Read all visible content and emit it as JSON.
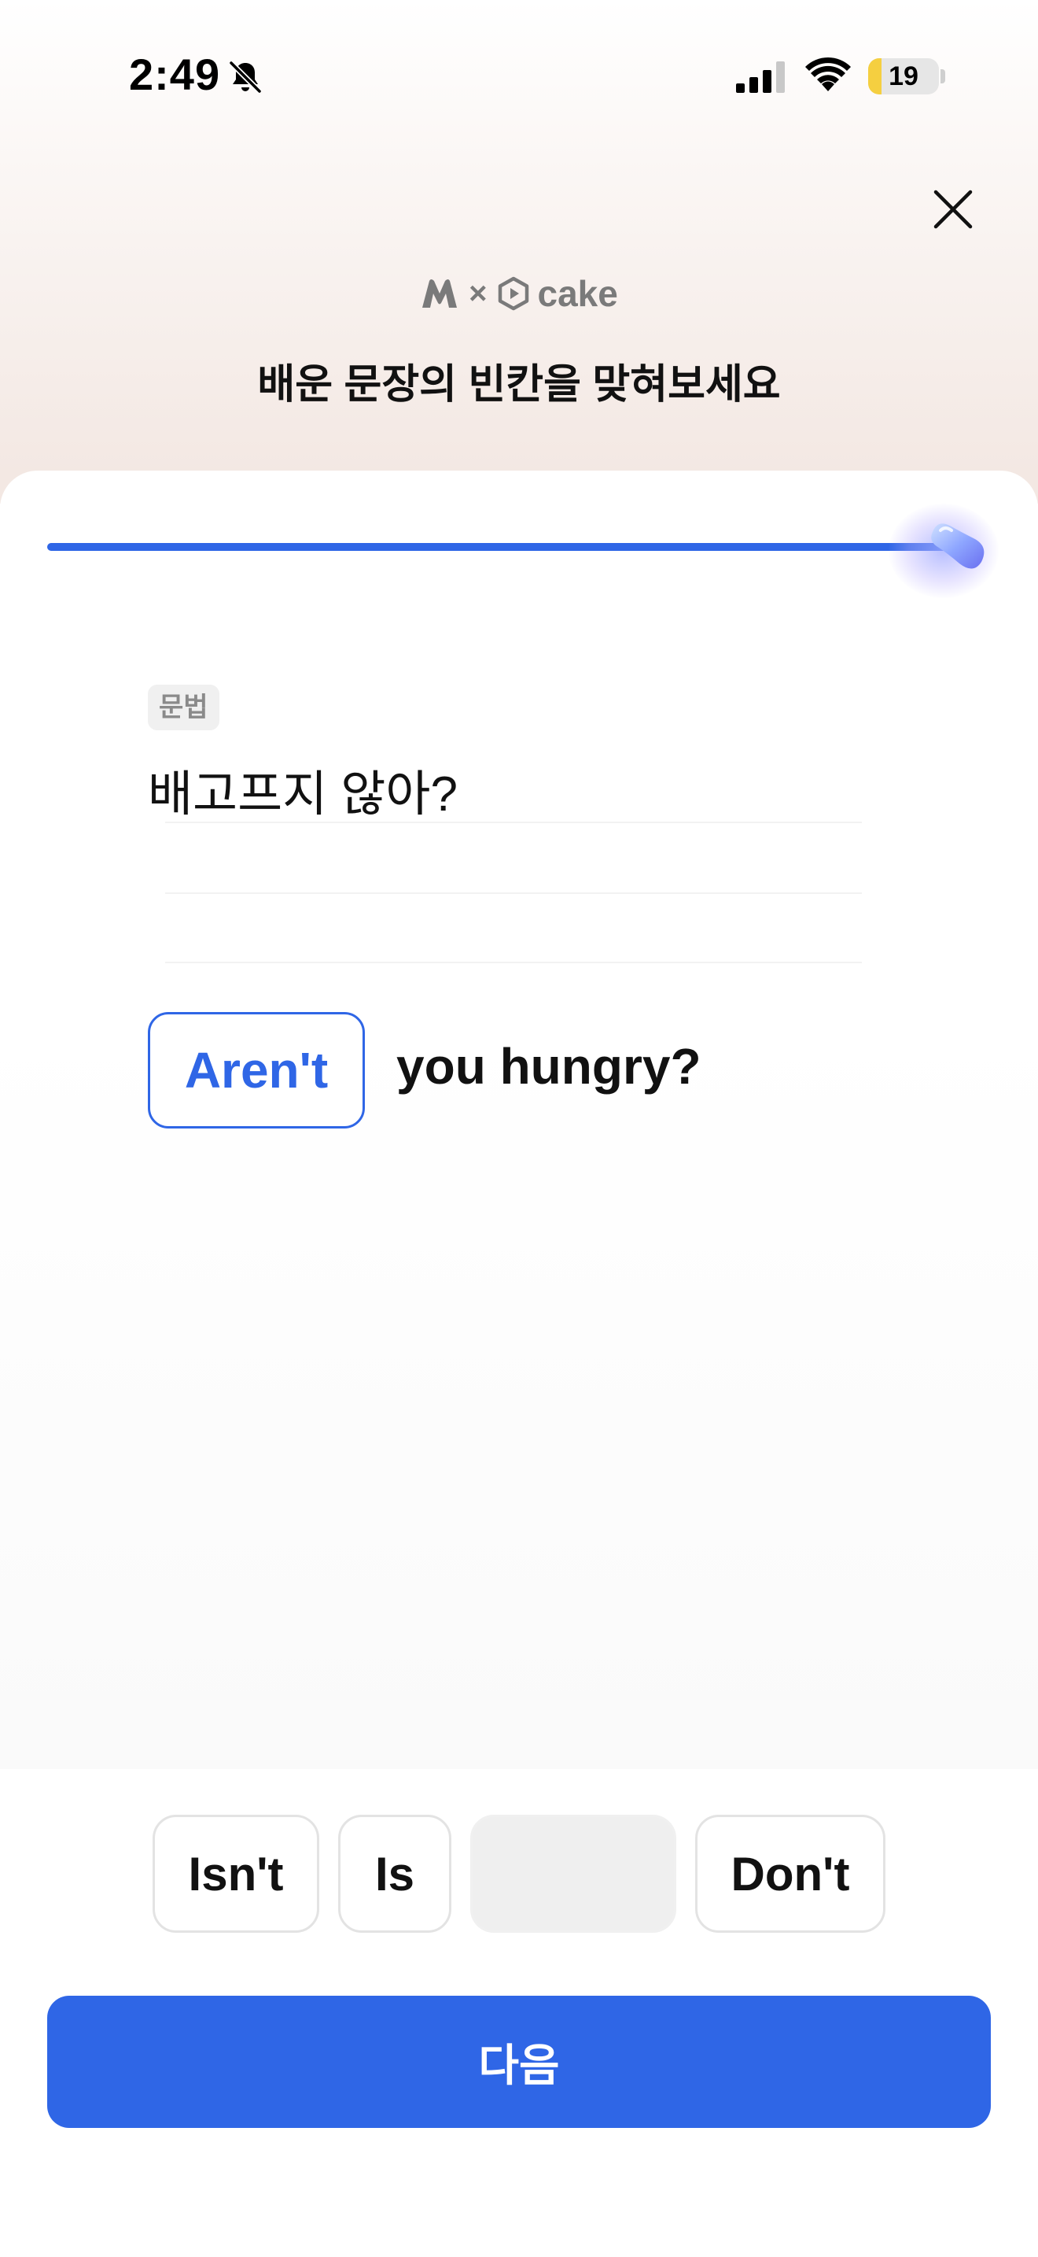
{
  "status_bar": {
    "time": "2:49",
    "battery_level": "19",
    "battery_fraction": 0.19,
    "icons": [
      "bell-slash-icon",
      "cellular-signal-icon",
      "wifi-icon",
      "battery-icon"
    ]
  },
  "header": {
    "brand_separator": "×",
    "brand_partner": "cake",
    "title": "배운 문장의 빈칸을 맞혀보세요",
    "close_icon": "close-icon"
  },
  "progress": {
    "fraction": 1.0,
    "color": "#2f66e6"
  },
  "question": {
    "tag": "문법",
    "korean_sentence": "배고프지 않아?",
    "selected_answer": "Aren't",
    "sentence_rest": "you hungry?"
  },
  "options": [
    {
      "label": "Isn't",
      "state": "available"
    },
    {
      "label": "Is",
      "state": "available"
    },
    {
      "label": "",
      "state": "used"
    },
    {
      "label": "Don't",
      "state": "available"
    }
  ],
  "next_button": {
    "label": "다음"
  },
  "colors": {
    "accent": "#2f66e6",
    "header_gradient_end": "#f3e8e3",
    "battery": "#f5cf40"
  }
}
